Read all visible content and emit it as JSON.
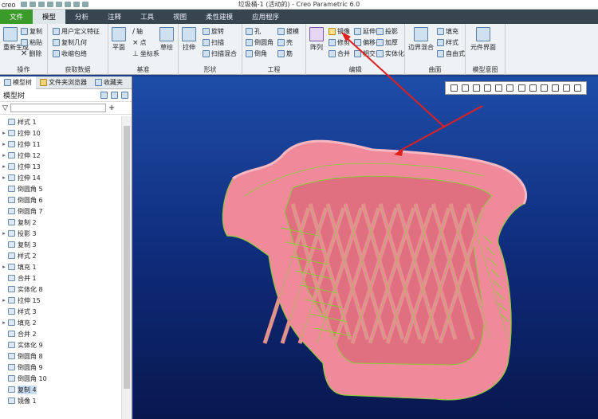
{
  "app": {
    "logo": "creo",
    "title": "垃圾桶-1 (活动的) - Creo Parametric 6.0"
  },
  "tabs": [
    {
      "label": "文件"
    },
    {
      "label": "模型"
    },
    {
      "label": "分析"
    },
    {
      "label": "注释"
    },
    {
      "label": "工具"
    },
    {
      "label": "视图"
    },
    {
      "label": "柔性建模"
    },
    {
      "label": "应用程序"
    }
  ],
  "ribbon": {
    "ops": {
      "label": "操作",
      "regen": "重新生成",
      "copy": "复制",
      "paste": "粘贴",
      "delete": "删除"
    },
    "getdata": {
      "label": "获取数据",
      "udf": "用户定义特征",
      "copygeom": "复制几何",
      "shrink": "收缩包络"
    },
    "datum": {
      "label": "基准",
      "plane": "平面",
      "axis": "轴",
      "point": "点",
      "csys": "坐标系",
      "sketch": "草绘"
    },
    "shapes": {
      "label": "形状",
      "extrude": "拉伸",
      "revolve": "旋转",
      "sweep": "扫描",
      "blend": "扫描混合"
    },
    "eng": {
      "label": "工程",
      "hole": "孔",
      "round": "倒圆角",
      "chamfer": "倒角",
      "draft": "拔模",
      "shell": "壳",
      "rib": "筋"
    },
    "edit": {
      "label": "编辑",
      "pattern": "阵列",
      "mirror": "镜像",
      "trim": "修剪",
      "merge": "合并",
      "extend": "延伸",
      "offset": "偏移",
      "intersect": "相交",
      "project": "投影",
      "thicken": "加厚",
      "solidify": "实体化"
    },
    "surf": {
      "label": "曲面",
      "boundary": "边界混合",
      "fill": "填充",
      "style": "样式",
      "freestyle": "自由式"
    },
    "intent": {
      "label": "模型意图",
      "comp": "元件界面"
    }
  },
  "leftpanel": {
    "tabs": [
      {
        "label": "模型树"
      },
      {
        "label": "文件夹浏览器"
      },
      {
        "label": "收藏夹"
      }
    ],
    "tree_title": "模型树",
    "filter_placeholder": ""
  },
  "tree": [
    {
      "label": "样式 1",
      "exp": ""
    },
    {
      "label": "拉伸 10",
      "exp": "▸"
    },
    {
      "label": "拉伸 11",
      "exp": "▸"
    },
    {
      "label": "拉伸 12",
      "exp": "▸"
    },
    {
      "label": "拉伸 13",
      "exp": "▸"
    },
    {
      "label": "拉伸 14",
      "exp": "▸"
    },
    {
      "label": "倒圆角 5",
      "exp": ""
    },
    {
      "label": "倒圆角 6",
      "exp": ""
    },
    {
      "label": "倒圆角 7",
      "exp": ""
    },
    {
      "label": "复制 2",
      "exp": ""
    },
    {
      "label": "投影 3",
      "exp": "▸"
    },
    {
      "label": "复制 3",
      "exp": ""
    },
    {
      "label": "样式 2",
      "exp": ""
    },
    {
      "label": "填充 1",
      "exp": "▸"
    },
    {
      "label": "合并 1",
      "exp": ""
    },
    {
      "label": "实体化 8",
      "exp": ""
    },
    {
      "label": "拉伸 15",
      "exp": "▸"
    },
    {
      "label": "样式 3",
      "exp": ""
    },
    {
      "label": "填充 2",
      "exp": "▸"
    },
    {
      "label": "合并 2",
      "exp": ""
    },
    {
      "label": "实体化 9",
      "exp": ""
    },
    {
      "label": "倒圆角 8",
      "exp": ""
    },
    {
      "label": "倒圆角 9",
      "exp": ""
    },
    {
      "label": "倒圆角 10",
      "exp": ""
    },
    {
      "label": "复制 4",
      "exp": "",
      "selected": true
    },
    {
      "label": "镜像 1",
      "exp": ""
    }
  ],
  "colors": {
    "model": "#f08a9a",
    "edges": "#8acc3a",
    "arrow": "#e02020"
  }
}
